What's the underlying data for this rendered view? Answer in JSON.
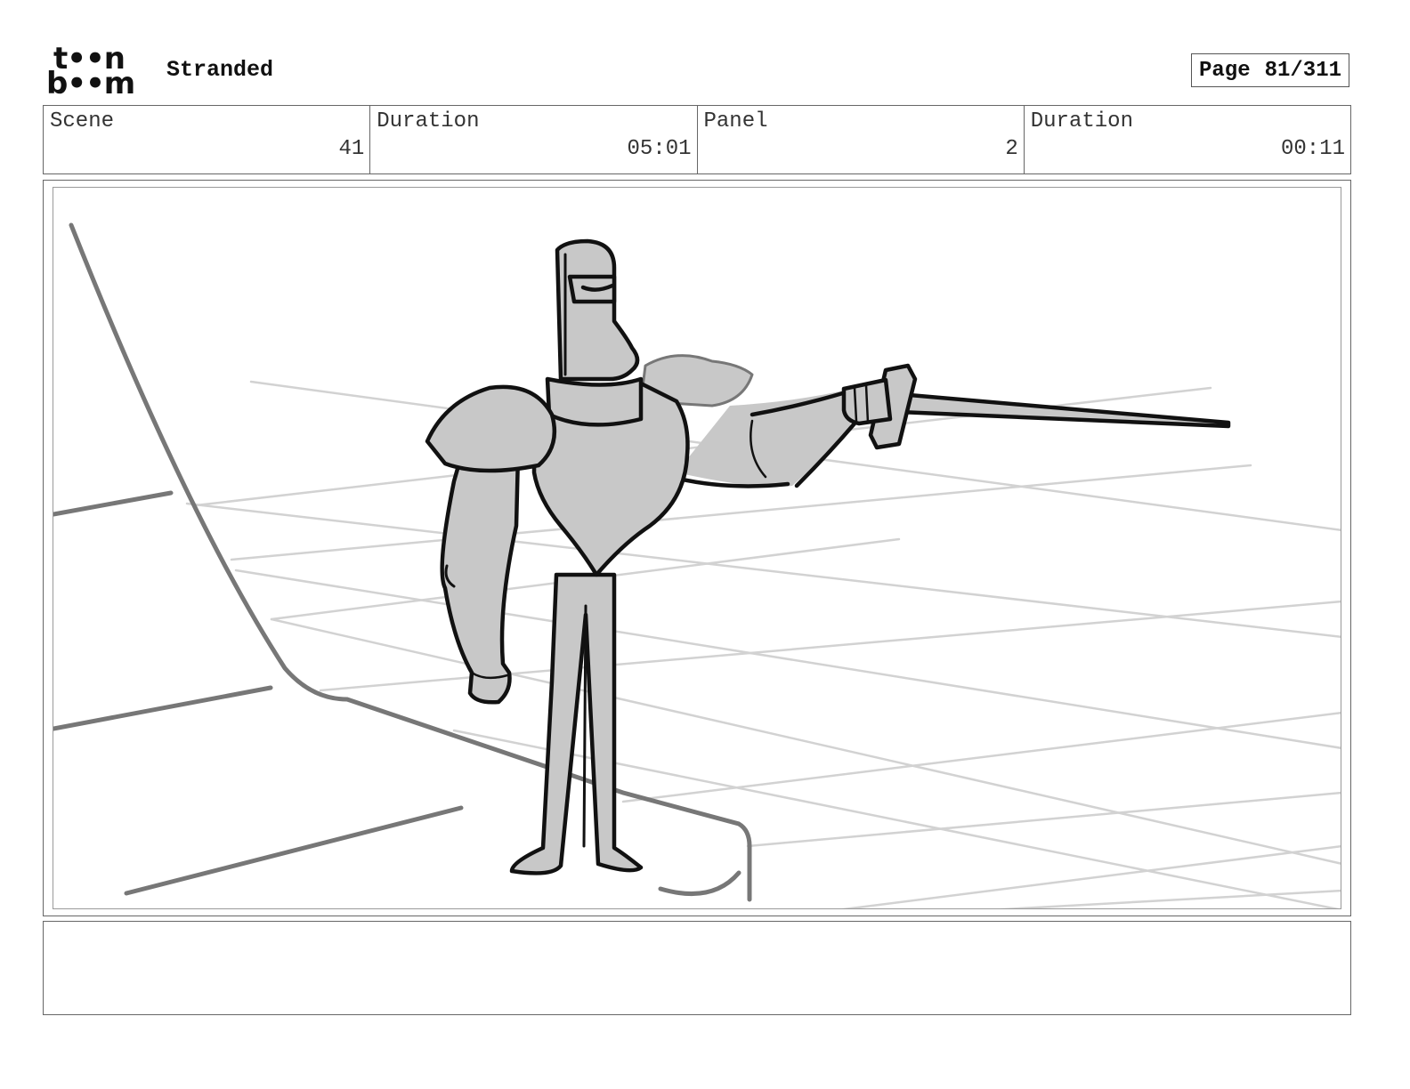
{
  "header": {
    "logo_top": "t••n",
    "logo_bottom": "b••m",
    "project_title": "Stranded",
    "page_label": "Page",
    "page_number": "81/311"
  },
  "info": {
    "scene_label": "Scene",
    "scene_value": "41",
    "scene_duration_label": "Duration",
    "scene_duration_value": "05:01",
    "panel_label": "Panel",
    "panel_value": "2",
    "panel_duration_label": "Duration",
    "panel_duration_value": "00:11"
  },
  "notes": {
    "text": ""
  },
  "colors": {
    "ink": "#111111",
    "armor_fill": "#c8c8c8",
    "grid_line": "#d0d0d0",
    "floor_edge": "#777777"
  }
}
